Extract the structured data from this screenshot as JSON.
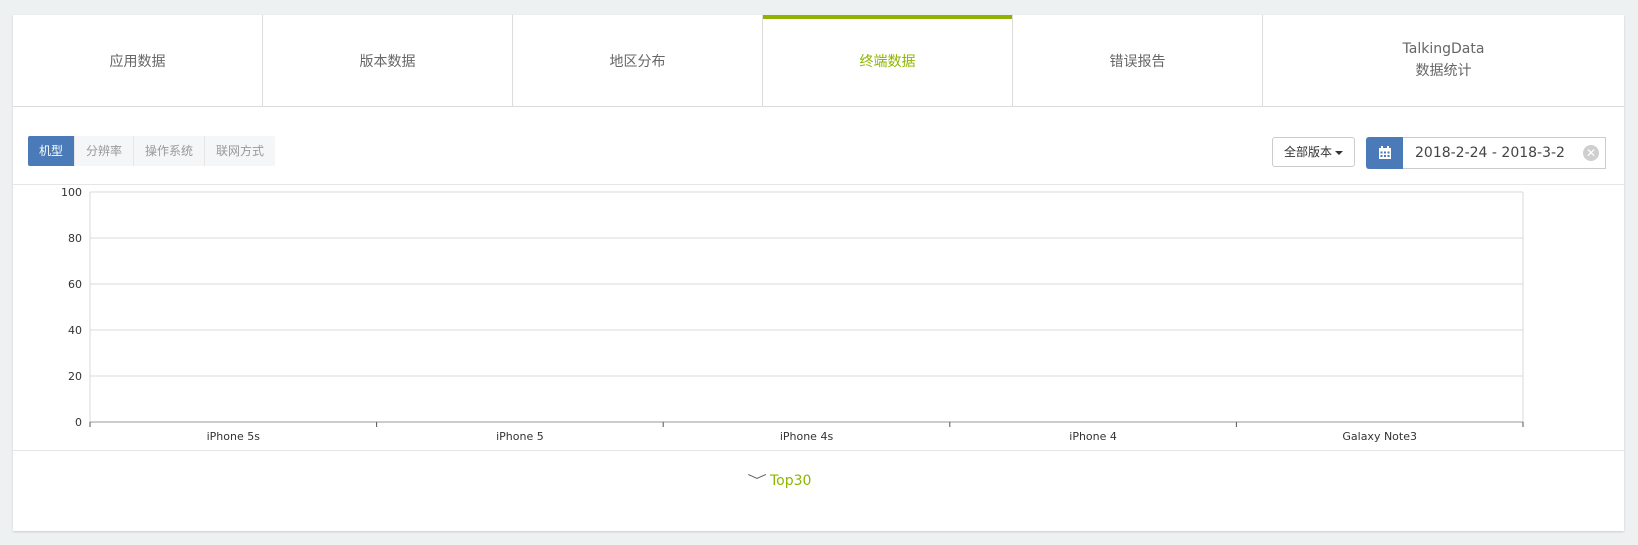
{
  "tabs": [
    {
      "line1": "应用数据",
      "line2": ""
    },
    {
      "line1": "版本数据",
      "line2": ""
    },
    {
      "line1": "地区分布",
      "line2": ""
    },
    {
      "line1": "终端数据",
      "line2": "",
      "active": true
    },
    {
      "line1": "错误报告",
      "line2": ""
    },
    {
      "line1": "TalkingData",
      "line2": "数据统计"
    }
  ],
  "segments": [
    "机型",
    "分辨率",
    "操作系统",
    "联网方式"
  ],
  "version_button": "全部版本",
  "date_range": "2018-2-24 - 2018-3-2",
  "more_label": "Top30",
  "colors": {
    "accent": "#8db600",
    "primary": "#4a7ab8"
  },
  "chart_data": {
    "type": "bar",
    "categories": [
      "iPhone 5s",
      "iPhone 5",
      "iPhone 4s",
      "iPhone 4",
      "Galaxy Note3"
    ],
    "values": [
      0,
      0,
      0,
      0,
      0
    ],
    "ylim": [
      0,
      100
    ],
    "yticks": [
      0,
      20,
      40,
      60,
      80,
      100
    ],
    "grid": true
  }
}
